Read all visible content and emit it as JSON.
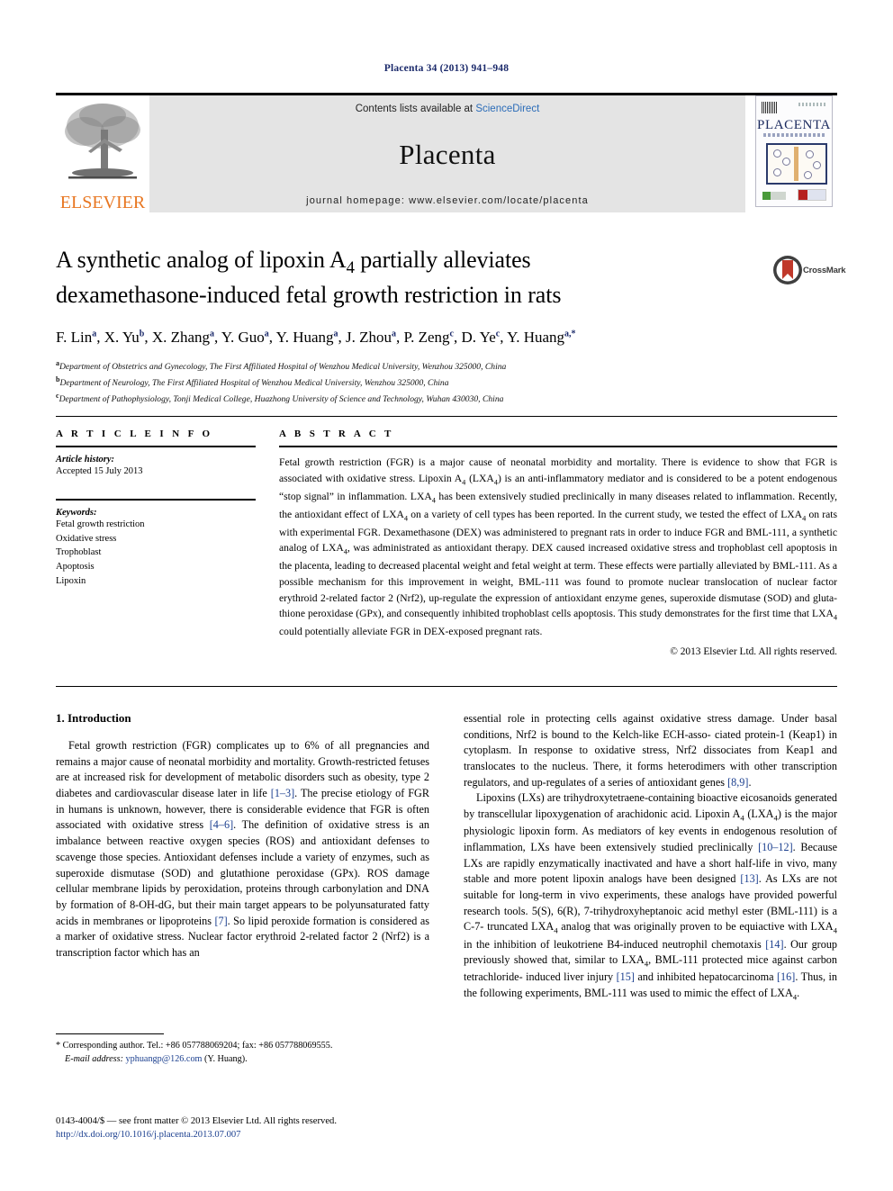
{
  "running_head": "Placenta 34 (2013) 941–948",
  "masthead": {
    "publisher_wordmark": "ELSEVIER",
    "contents_prefix": "Contents lists available at",
    "sciencedirect_link": "ScienceDirect",
    "journal_name": "Placenta",
    "homepage_text": "journal homepage: www.elsevier.com/locate/placenta",
    "cover_title": "PLACENTA",
    "link_color": "#2b6cb8",
    "elsevier_orange": "#e87722"
  },
  "crossmark": {
    "label": "CrossMark"
  },
  "article": {
    "title_line1": "A synthetic analog of lipoxin A",
    "title_sub1": "4",
    "title_line1_rest": " partially alleviates",
    "title_line2": "dexamethasone-induced fetal growth restriction in rats",
    "authors": [
      {
        "name": "F. Lin",
        "mark": "a"
      },
      {
        "name": "X. Yu",
        "mark": "b"
      },
      {
        "name": "X. Zhang",
        "mark": "a"
      },
      {
        "name": "Y. Guo",
        "mark": "a"
      },
      {
        "name": "Y. Huang",
        "mark": "a"
      },
      {
        "name": "J. Zhou",
        "mark": "a"
      },
      {
        "name": "P. Zeng",
        "mark": "c"
      },
      {
        "name": "D. Ye",
        "mark": "c"
      },
      {
        "name": "Y. Huang",
        "mark": "a,*"
      }
    ],
    "affiliations": [
      {
        "mark": "a",
        "text": "Department of Obstetrics and Gynecology, The First Affiliated Hospital of Wenzhou Medical University, Wenzhou 325000, China"
      },
      {
        "mark": "b",
        "text": "Department of Neurology, The First Affiliated Hospital of Wenzhou Medical University, Wenzhou 325000, China"
      },
      {
        "mark": "c",
        "text": "Department of Pathophysiology, Tonji Medical College, Huazhong University of Science and Technology, Wuhan 430030, China"
      }
    ]
  },
  "article_info": {
    "heading": "A R T I C L E   I N F O",
    "history_label": "Article history:",
    "history_value": "Accepted 15 July 2013",
    "keywords_label": "Keywords:",
    "keywords": [
      "Fetal growth restriction",
      "Oxidative stress",
      "Trophoblast",
      "Apoptosis",
      "Lipoxin"
    ]
  },
  "abstract": {
    "heading": "A B S T R A C T",
    "body": "Fetal growth restriction (FGR) is a major cause of neonatal morbidity and mortality. There is evidence to show that FGR is associated with oxidative stress. Lipoxin A4 (LXA4) is an anti-inflammatory mediator and is considered to be a potent endogenous “stop signal” in inflammation. LXA4 has been extensively studied preclinically in many diseases related to inflammation. Recently, the antioxidant effect of LXA4 on a variety of cell types has been reported. In the current study, we tested the effect of LXA4 on rats with experimental FGR. Dexamethasone (DEX) was administered to pregnant rats in order to induce FGR and BML-111, a synthetic analog of LXA4, was administrated as antioxidant therapy. DEX caused increased oxidative stress and trophoblast cell apoptosis in the placenta, leading to decreased placental weight and fetal weight at term. These effects were partially alleviated by BML-111. As a possible mechanism for this improvement in weight, BML-111 was found to promote nuclear translocation of nuclear factor erythroid 2-related factor 2 (Nrf2), up-regulate the expression of antioxidant enzyme genes, superoxide dismutase (SOD) and glutathione peroxidase (GPx), and consequently inhibited trophoblast cells apoptosis. This study demonstrates for the first time that LXA4 could potentially alleviate FGR in DEX-exposed pregnant rats.",
    "copyright": "© 2013 Elsevier Ltd. All rights reserved."
  },
  "introduction": {
    "heading": "1.  Introduction",
    "paragraph1": "Fetal growth restriction (FGR) complicates up to 6% of all pregnancies and remains a major cause of neonatal morbidity and mortality. Growth-restricted fetuses are at increased risk for development of metabolic disorders such as obesity, type 2 diabetes and cardiovascular disease later in life [1–3]. The precise etiology of FGR in humans is unknown, however, there is considerable evidence that FGR is often associated with oxidative stress [4–6]. The definition of oxidative stress is an imbalance between reactive oxygen species (ROS) and antioxidant defenses to scavenge those species. Antioxidant defenses include a variety of enzymes, such as superoxide dismutase (SOD) and glutathione peroxidase (GPx). ROS damage cellular membrane lipids by peroxidation, proteins through carbonylation and DNA by formation of 8-OH-dG, but their main target appears to be polyunsaturated fatty acids in membranes or lipoproteins [7]. So lipid peroxide formation is considered as a marker of oxidative stress. Nuclear factor erythroid 2-related factor 2 (Nrf2) is a transcription factor which has an essential role in protecting cells against oxidative stress damage. Under basal conditions, Nrf2 is bound to the Kelch-like ECH-associated protein-1 (Keap1) in cytoplasm. In response to oxidative stress, Nrf2 dissociates from Keap1 and translocates to the nucleus. There, it forms heterodimers with other transcription regulators, and up-regulates of a series of antioxidant genes [8,9].",
    "paragraph2": "Lipoxins (LXs) are trihydroxytetraene-containing bioactive eicosanoids generated by transcellular lipoxygenation of arachidonic acid. Lipoxin A4 (LXA4) is the major physiologic lipoxin form. As mediators of key events in endogenous resolution of inflammation, LXs have been extensively studied preclinically [10–12]. Because LXs are rapidly enzymatically inactivated and have a short half-life in vivo, many stable and more potent lipoxin analogs have been designed [13]. As LXs are not suitable for long-term in vivo experiments, these analogs have provided powerful research tools. 5(S), 6(R), 7-trihydroxyheptanoic acid methyl ester (BML-111) is a C-7-truncated LXA4 analog that was originally proven to be equiactive with LXA4 in the inhibition of leukotriene B4-induced neutrophil chemotaxis [14]. Our group previously showed that, similar to LXA4, BML-111 protected mice against carbon tetrachloride-induced liver injury [15] and inhibited hepatocarcinoma [16]. Thus, in the following experiments, BML-111 was used to mimic the effect of LXA4."
  },
  "footnote": {
    "line1": "* Corresponding author. Tel.: +86 057788069204; fax: +86 057788069555.",
    "email_label": "E-mail address:",
    "email": "yphuangp@126.com",
    "email_owner": "(Y. Huang)."
  },
  "footer": {
    "issn_line": "0143-4004/$ — see front matter © 2013 Elsevier Ltd. All rights reserved.",
    "doi": "http://dx.doi.org/10.1016/j.placenta.2013.07.007"
  }
}
